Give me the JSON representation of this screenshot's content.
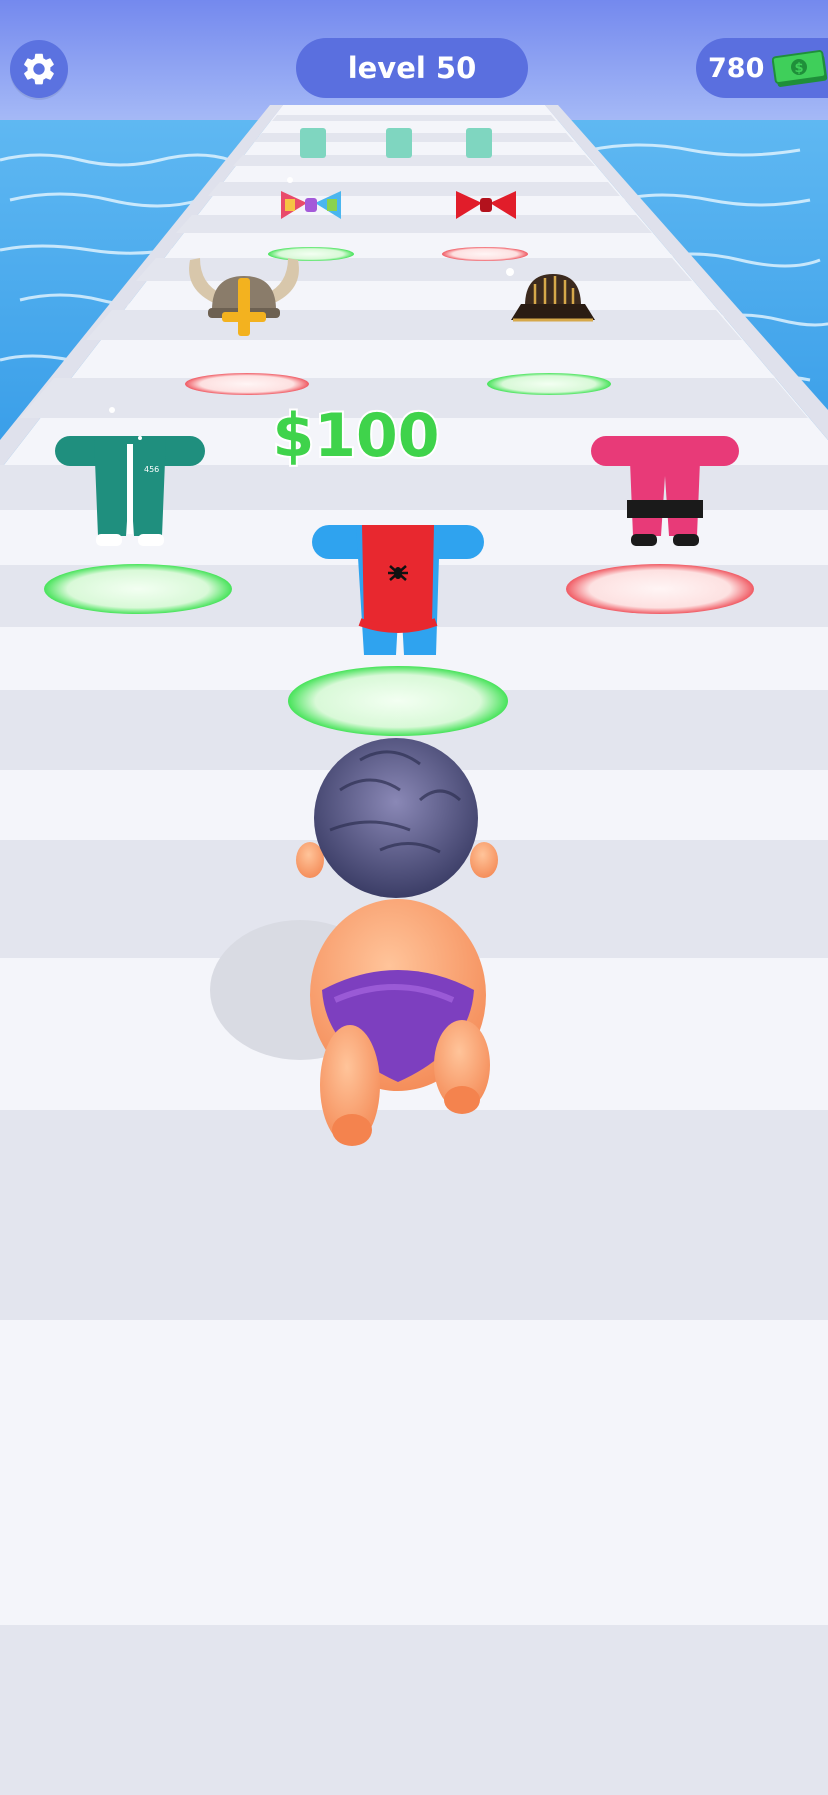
{
  "hud": {
    "settings_icon": "gear-icon",
    "level_label": "level 50",
    "currency_amount": "780",
    "currency_icon": "cash-icon"
  },
  "scene": {
    "reward_label": "$100",
    "colors": {
      "sky": "#7f93f0",
      "water": "#3ea9ee",
      "track": "#f2f3f8",
      "good_ring": "#47e35a",
      "bad_ring": "#f05a63",
      "reward_text": "#3fd34b",
      "hud_pill": "#5a6fdf"
    },
    "items": [
      {
        "name": "rainbow-bow-tie",
        "zone": "good"
      },
      {
        "name": "red-bow-tie",
        "zone": "bad"
      },
      {
        "name": "viking-helmet",
        "zone": "bad"
      },
      {
        "name": "samurai-helmet",
        "zone": "good"
      },
      {
        "name": "green-tracksuit",
        "zone": "good"
      },
      {
        "name": "spider-suit",
        "zone": "good"
      },
      {
        "name": "pink-suit",
        "zone": "bad"
      }
    ],
    "player": "baby-character"
  }
}
